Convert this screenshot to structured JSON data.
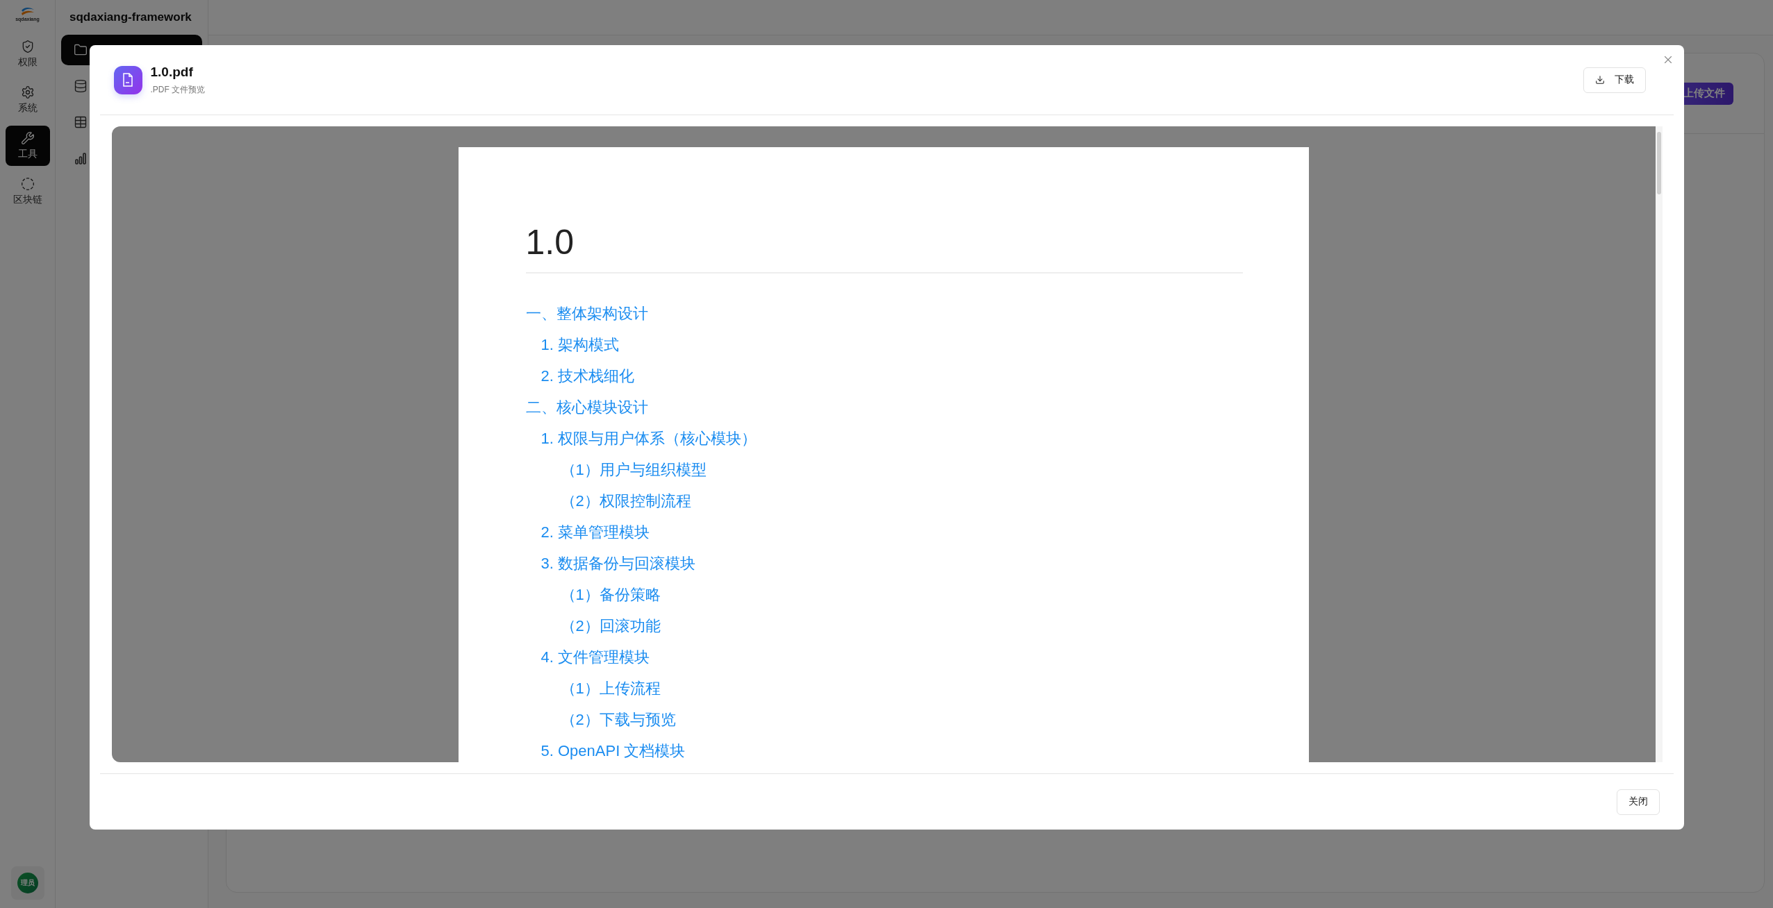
{
  "app": {
    "rail": {
      "logo_text": "sqdaxiang",
      "items": [
        {
          "kind": "shield",
          "label": "权限",
          "selected": false
        },
        {
          "kind": "gear",
          "label": "系统",
          "selected": false
        },
        {
          "kind": "tools",
          "label": "工具",
          "selected": true
        },
        {
          "kind": "chain",
          "label": "区块链",
          "selected": false
        }
      ],
      "avatar": "理员"
    },
    "sidebar": {
      "title": "sqdaxiang-framework",
      "items": [
        {
          "kind": "folder",
          "selected": true
        },
        {
          "kind": "database",
          "selected": false
        },
        {
          "kind": "table",
          "selected": false
        },
        {
          "kind": "chart",
          "selected": false
        }
      ]
    },
    "upload_button": "上传文件"
  },
  "dialog": {
    "title": "1.0.pdf",
    "subtitle": ".PDF 文件预览",
    "download_button": "下载",
    "close_button": "关闭",
    "document": {
      "heading": "1.0",
      "toc": [
        {
          "text": "一、整体架构设计",
          "children": [
            {
              "text": "1. 架构模式"
            },
            {
              "text": "2. 技术栈细化"
            }
          ]
        },
        {
          "text": "二、核心模块设计",
          "children": [
            {
              "text": "1. 权限与用户体系（核心模块）",
              "children": [
                {
                  "text": "（1）用户与组织模型"
                },
                {
                  "text": "（2）权限控制流程"
                }
              ]
            },
            {
              "text": "2. 菜单管理模块"
            },
            {
              "text": "3. 数据备份与回滚模块",
              "children": [
                {
                  "text": "（1）备份策略"
                },
                {
                  "text": "（2）回滚功能"
                }
              ]
            },
            {
              "text": "4. 文件管理模块",
              "children": [
                {
                  "text": "（1）上传流程"
                },
                {
                  "text": "（2）下载与预览"
                }
              ]
            },
            {
              "text": "5. OpenAPI 文档模块"
            }
          ]
        }
      ]
    }
  }
}
